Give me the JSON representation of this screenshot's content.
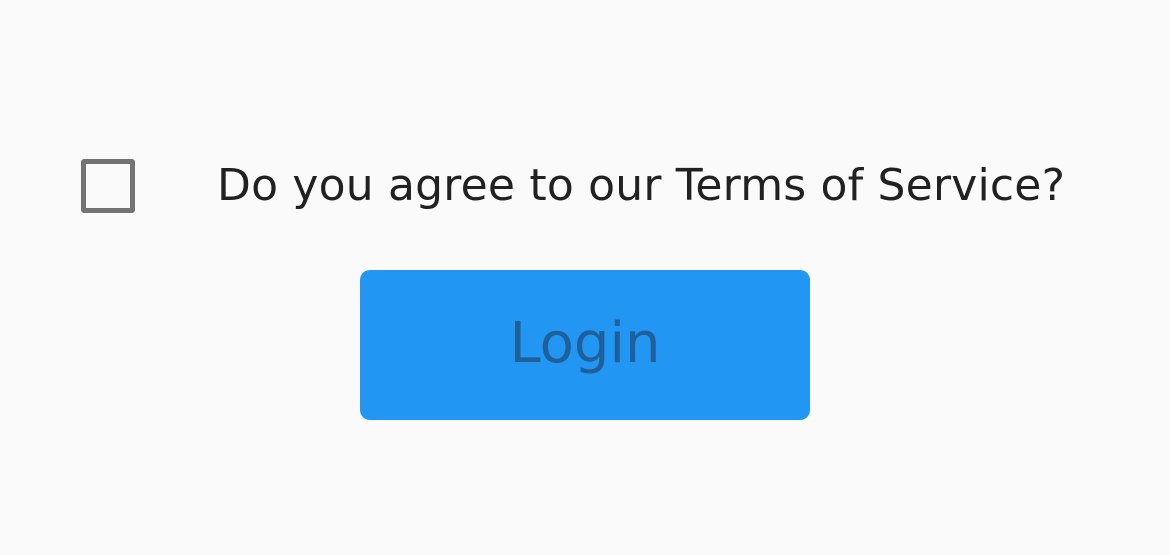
{
  "terms": {
    "checked": false,
    "label": "Do you agree to our Terms of Service?"
  },
  "login_button": {
    "label": "Login"
  },
  "colors": {
    "background": "#fafafa",
    "button": "#2196f3",
    "button_text": "#1f5f9a",
    "text": "#212121",
    "checkbox_border": "#737373"
  }
}
